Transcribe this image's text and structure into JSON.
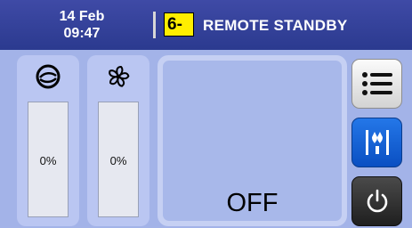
{
  "header": {
    "date": "14 Feb",
    "time": "09:47",
    "mode_code": "6-",
    "mode_label": "REMOTE STANDBY"
  },
  "gauges": [
    {
      "icon": "compressor-icon",
      "value": "0%"
    },
    {
      "icon": "fan-icon",
      "value": "0%"
    }
  ],
  "main": {
    "status": "OFF"
  },
  "side_buttons": [
    {
      "icon": "list-menu-icon"
    },
    {
      "icon": "water-drain-icon"
    },
    {
      "icon": "power-icon"
    }
  ],
  "colors": {
    "header_bg": "#2b3a8f",
    "background": "#a3b3e8",
    "mode_code_bg": "#ffee00",
    "water_button": "#0a4fc2",
    "power_button": "#1f1f1f"
  }
}
